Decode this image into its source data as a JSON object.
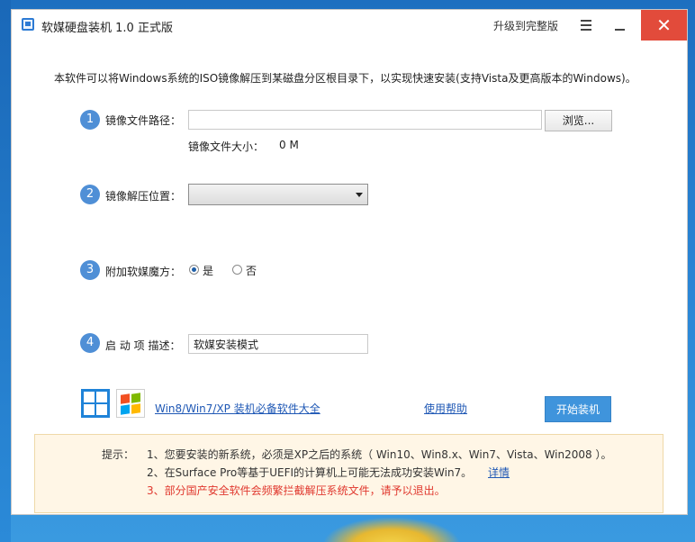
{
  "window": {
    "title": "软媒硬盘装机 1.0 正式版",
    "upgrade_label": "升级到完整版",
    "close_glyph": "✕"
  },
  "intro": "本软件可以将Windows系统的ISO镜像解压到某磁盘分区根目录下，以实现快速安装(支持Vista及更高版本的Windows)。",
  "steps": [
    {
      "num": "1",
      "label": "镜像文件路径："
    },
    {
      "num": "2",
      "label": "镜像解压位置："
    },
    {
      "num": "3",
      "label": "附加软媒魔方："
    },
    {
      "num": "4",
      "label": "启 动 项 描述："
    }
  ],
  "image_path": {
    "value": "",
    "browse_label": "浏览...",
    "size_label": "镜像文件大小：",
    "size_value": "0 M"
  },
  "extract_location": {
    "selected": ""
  },
  "addon": {
    "yes_label": "是",
    "no_label": "否",
    "selected": "yes"
  },
  "boot_desc": {
    "value": "软媒安装模式"
  },
  "footer": {
    "software_link": "Win8/Win7/XP 装机必备软件大全",
    "help_link": "使用帮助",
    "install_button": "开始装机"
  },
  "notice": {
    "label": "提示：",
    "tips": [
      "1、您要安装的新系统，必须是XP之后的系统（ Win10、Win8.x、Win7、Vista、Win2008 ）。",
      "2、在Surface Pro等基于UEFI的计算机上可能无法成功安装Win7。",
      "3、部分国产安全软件会频繁拦截解压系统文件，请予以退出。"
    ],
    "detail_link": "详情"
  },
  "colors": {
    "accent": "#3f94dc",
    "step_circle": "#4f8fd6",
    "close_bg": "#e24b3b",
    "warning_text": "#e0382e",
    "link": "#1f58b5"
  },
  "icons": [
    "app-icon",
    "menu-icon",
    "minimize-icon",
    "close-icon",
    "windows8-logo-icon",
    "windows7-logo-icon",
    "dropdown-arrow-icon"
  ]
}
